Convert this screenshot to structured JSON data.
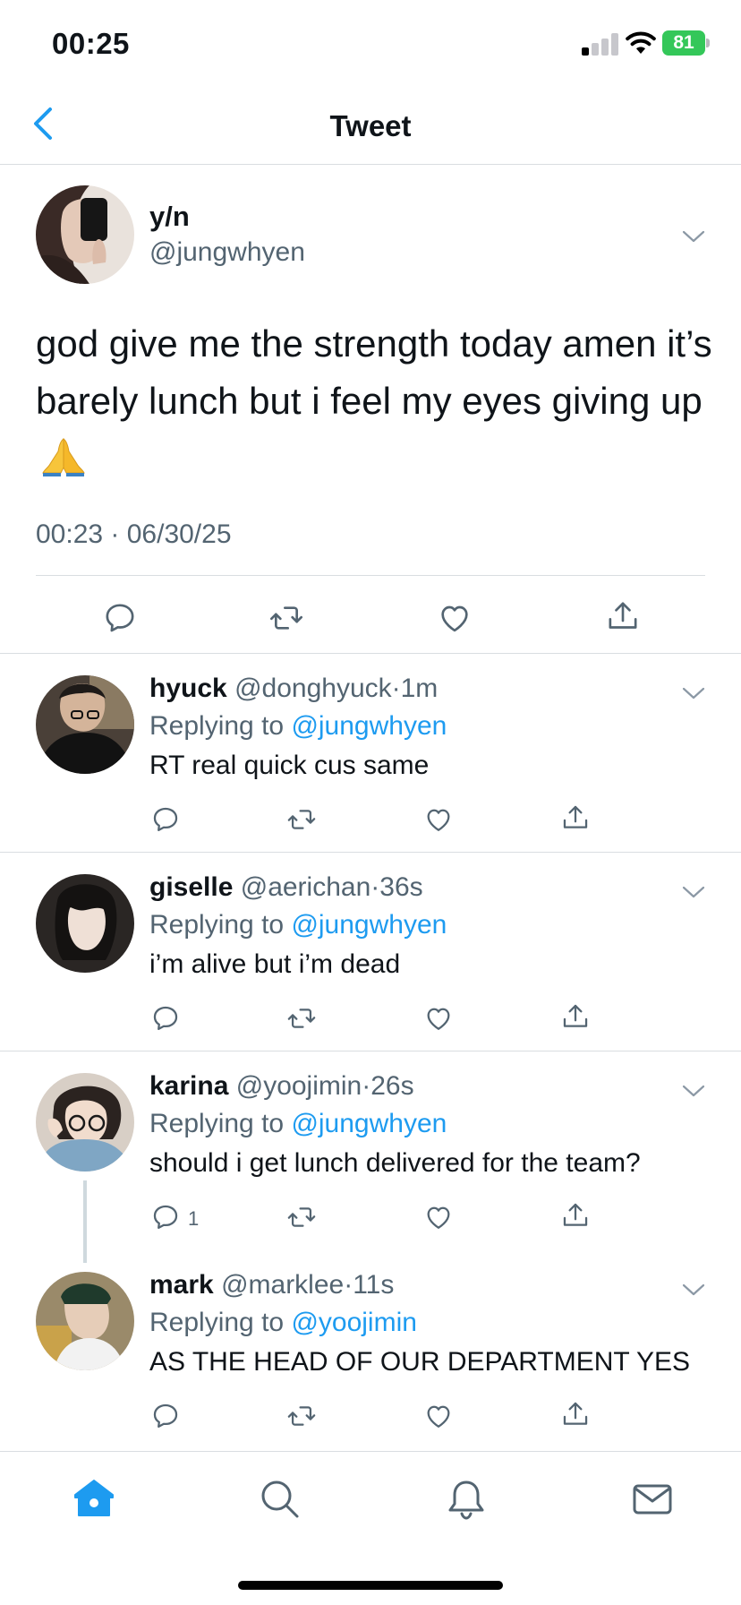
{
  "status_bar": {
    "time": "00:25",
    "battery": "81"
  },
  "header": {
    "title": "Tweet"
  },
  "main_tweet": {
    "name": "y/n",
    "handle": "@jungwhyen",
    "text": "god give me the strength today amen it’s barely lunch but i feel my eyes giving up",
    "emoji": "folded-hands",
    "timestamp": "00:23 · 06/30/25"
  },
  "replies": [
    {
      "name": "hyuck",
      "handle": "@donghyuck",
      "time": "1m",
      "replying_label": "Replying to",
      "replying_to": "@jungwhyen",
      "text": "RT real quick cus same",
      "reply_count": ""
    },
    {
      "name": "giselle",
      "handle": "@aerichan",
      "time": "36s",
      "replying_label": "Replying to",
      "replying_to": "@jungwhyen",
      "text": "i’m alive but i’m dead",
      "reply_count": ""
    },
    {
      "name": "karina",
      "handle": "@yoojimin",
      "time": "26s",
      "replying_label": "Replying to",
      "replying_to": "@jungwhyen",
      "text": "should i get lunch delivered for the team?",
      "reply_count": "1"
    },
    {
      "name": "mark",
      "handle": "@marklee",
      "time": "11s",
      "replying_label": "Replying to",
      "replying_to": "@yoojimin",
      "text": "AS THE HEAD OF OUR DEPARTMENT YES",
      "reply_count": ""
    }
  ],
  "meta_separator": "·",
  "tab_bar": {
    "items": [
      {
        "icon": "home-icon",
        "active": true
      },
      {
        "icon": "search-icon",
        "active": false
      },
      {
        "icon": "bell-icon",
        "active": false
      },
      {
        "icon": "mail-icon",
        "active": false
      }
    ]
  },
  "colors": {
    "accent": "#1d9bf0",
    "secondary_text": "#536471",
    "divider": "#d9dde1",
    "battery": "#34c759"
  }
}
